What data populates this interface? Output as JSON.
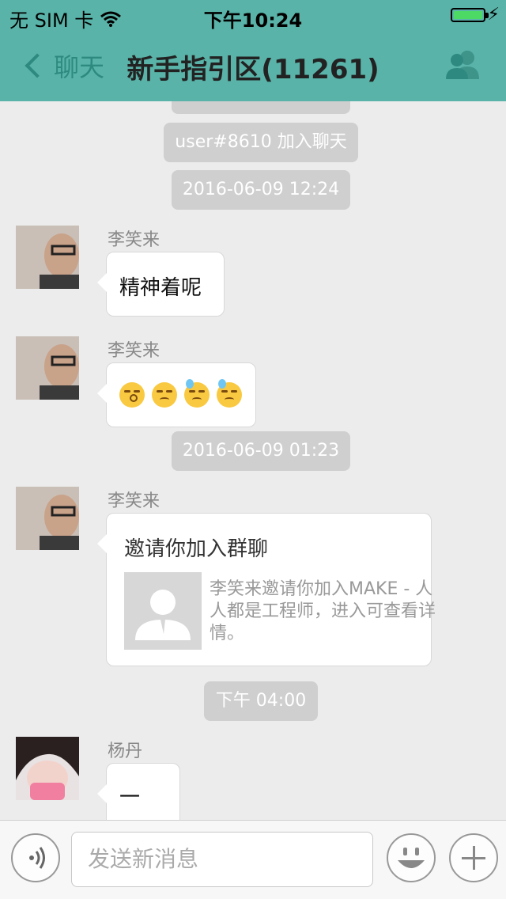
{
  "status_bar": {
    "carrier": "无 SIM 卡",
    "time": "下午10:24"
  },
  "nav": {
    "back_label": "聊天",
    "title": "新手指引区(11261)"
  },
  "chat": {
    "system_messages": [
      "user#8610 加入聊天",
      "2016-06-09 12:24",
      "2016-06-09 01:23",
      "下午 04:00"
    ],
    "messages": [
      {
        "sender": "李笑来",
        "text": "精神着呢"
      },
      {
        "sender": "李笑来",
        "emoji": [
          "kissing-face",
          "disappointed-face",
          "sweat-face",
          "sweat-face"
        ]
      },
      {
        "sender": "李笑来",
        "invite_title": "邀请你加入群聊",
        "invite_desc": "李笑来邀请你加入MAKE - 人人都是工程师，进入可查看详情。"
      },
      {
        "sender": "杨丹",
        "text": "一"
      }
    ]
  },
  "input_bar": {
    "placeholder": "发送新消息"
  }
}
